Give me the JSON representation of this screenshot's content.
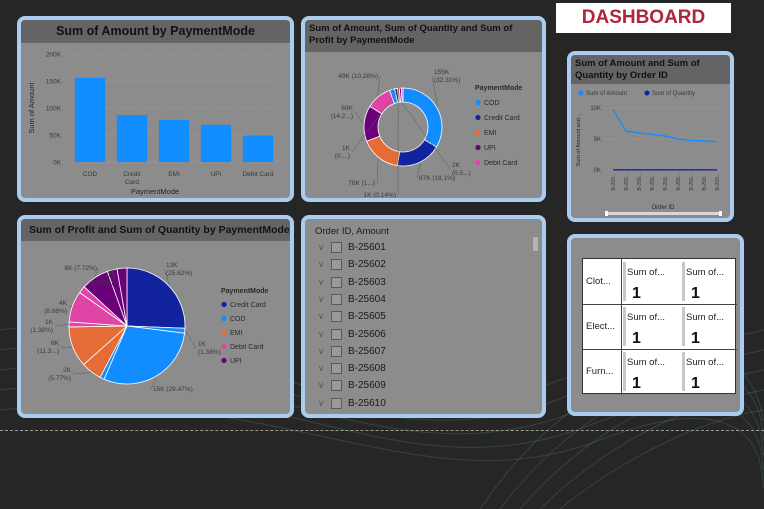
{
  "dashboard_title": "DASHBOARD",
  "colors": {
    "cod": "#118dff",
    "credit_card": "#12239e",
    "emi": "#e66c37",
    "upi": "#6b007b",
    "debit_card": "#e044a7",
    "panel_border": "#a9cdee"
  },
  "chart_data": [
    {
      "id": "bar",
      "type": "bar",
      "title": "Sum of Amount by PaymentMode",
      "xlabel": "PaymentMode",
      "ylabel": "Sum of Amount",
      "categories": [
        "COD",
        "Credit Card",
        "EMI",
        "UPI",
        "Debit Card"
      ],
      "category_labels": [
        [
          "COD"
        ],
        [
          "Credit",
          "Card"
        ],
        [
          "EMI"
        ],
        [
          "UPI"
        ],
        [
          "Debit Card"
        ]
      ],
      "values": [
        156000,
        87000,
        78000,
        69000,
        49000
      ],
      "ylim": [
        0,
        200000
      ],
      "yticks": [
        0,
        50000,
        100000,
        150000,
        200000
      ],
      "ytick_labels": [
        "0K",
        "50K",
        "100K",
        "150K",
        "200K"
      ],
      "grid": true
    },
    {
      "id": "donut",
      "type": "pie",
      "title": "Sum of Amount, Sum of Quantity and Sum of Profit by PaymentMode",
      "legend_title": "PaymentMode",
      "legend": [
        "COD",
        "Credit Card",
        "EMI",
        "UPI",
        "Debit Card"
      ],
      "slices": [
        {
          "name": "COD",
          "value": 156,
          "label": [
            "155K",
            "(32.31%)"
          ]
        },
        {
          "name": "Credit Card",
          "value": 87,
          "label": [
            "87K (18.1%)"
          ]
        },
        {
          "name": "EMI",
          "value": 78,
          "label": [
            "78K (1...)"
          ]
        },
        {
          "name": "UPI",
          "value": 69,
          "label": [
            "69K",
            "(14.2...)"
          ]
        },
        {
          "name": "Debit Card",
          "value": 49,
          "label": [
            "49K (10.28%)"
          ]
        },
        {
          "name": "COD",
          "value": 10,
          "label": [
            "2K",
            "(0.5...)"
          ]
        },
        {
          "name": "Credit Card",
          "value": 5,
          "label": []
        },
        {
          "name": "EMI",
          "value": 4,
          "label": [
            "1K (0.14%)"
          ]
        },
        {
          "name": "UPI",
          "value": 4,
          "label": [
            "1K",
            "(0....)"
          ]
        },
        {
          "name": "Debit Card",
          "value": 3,
          "label": []
        }
      ]
    },
    {
      "id": "line",
      "type": "line",
      "title": "Sum of Amount and Sum of Quantity by Order ID",
      "legend": [
        "Sum of Amount",
        "Sum of Quantity"
      ],
      "xlabel": "Order ID",
      "ylabel": "Sum of Amount and...",
      "categories": [
        "B-260...",
        "B-259...",
        "B-259...",
        "B-258...",
        "B-259...",
        "B-258...",
        "B-256...",
        "B-258...",
        "B-260..."
      ],
      "series": [
        {
          "name": "Sum of Amount",
          "values": [
            9800,
            6300,
            6000,
            5800,
            5500,
            5000,
            4800,
            4700,
            4600
          ]
        },
        {
          "name": "Sum of Quantity",
          "values": [
            30,
            28,
            27,
            26,
            27,
            26,
            25,
            26,
            25
          ]
        }
      ],
      "ylim": [
        0,
        11000
      ],
      "yticks": [
        0,
        5000,
        10000
      ],
      "ytick_labels": [
        "0K",
        "5K",
        "10K"
      ],
      "grid": true
    },
    {
      "id": "pie",
      "type": "pie",
      "title": "Sum of Profit and Sum of Quantity by PaymentMode",
      "legend_title": "PaymentMode",
      "legend": [
        "Credit Card",
        "COD",
        "EMI",
        "Debit Card",
        "UPI"
      ],
      "slices": [
        {
          "name": "Credit Card",
          "value": 25.62,
          "label": [
            "13K",
            "(25.62%)"
          ]
        },
        {
          "name": "COD",
          "value": 1.38,
          "label": [
            "1K",
            "(1.38%)"
          ]
        },
        {
          "name": "COD",
          "value": 29.47,
          "label": [
            "15K (29.47%)"
          ]
        },
        {
          "name": "COD",
          "value": 1.2,
          "label": []
        },
        {
          "name": "EMI",
          "value": 5.77,
          "label": [
            "2K",
            "(5.77%)"
          ]
        },
        {
          "name": "EMI",
          "value": 11.3,
          "label": [
            "6K",
            "(11.3...)"
          ]
        },
        {
          "name": "Debit Card",
          "value": 1.38,
          "label": [
            "1K",
            "(1.38%)"
          ]
        },
        {
          "name": "Debit Card",
          "value": 8.68,
          "label": [
            "4K",
            "(8.68%)"
          ]
        },
        {
          "name": "Debit Card",
          "value": 2.0,
          "label": []
        },
        {
          "name": "UPI",
          "value": 7.72,
          "label": [
            "8K (7.72%)"
          ]
        },
        {
          "name": "UPI",
          "value": 2.72,
          "label": [
            "1K",
            "(2.72%)"
          ]
        },
        {
          "name": "UPI",
          "value": 2.76,
          "label": []
        }
      ]
    }
  ],
  "slicer": {
    "header": "Order ID, Amount",
    "items": [
      "B-25601",
      "B-25602",
      "B-25603",
      "B-25604",
      "B-25605",
      "B-25606",
      "B-25607",
      "B-25608",
      "B-25609",
      "B-25610"
    ]
  },
  "matrix": {
    "rows": [
      "Clot...",
      "Elect...",
      "Furn..."
    ],
    "col1": [
      "Sum of...",
      "Sum of...",
      "Sum of..."
    ],
    "col2": [
      "Sum of...",
      "Sum of...",
      "Sum of..."
    ],
    "val1": [
      "1",
      "1",
      "1"
    ],
    "val2": [
      "1",
      "1",
      "1"
    ]
  }
}
